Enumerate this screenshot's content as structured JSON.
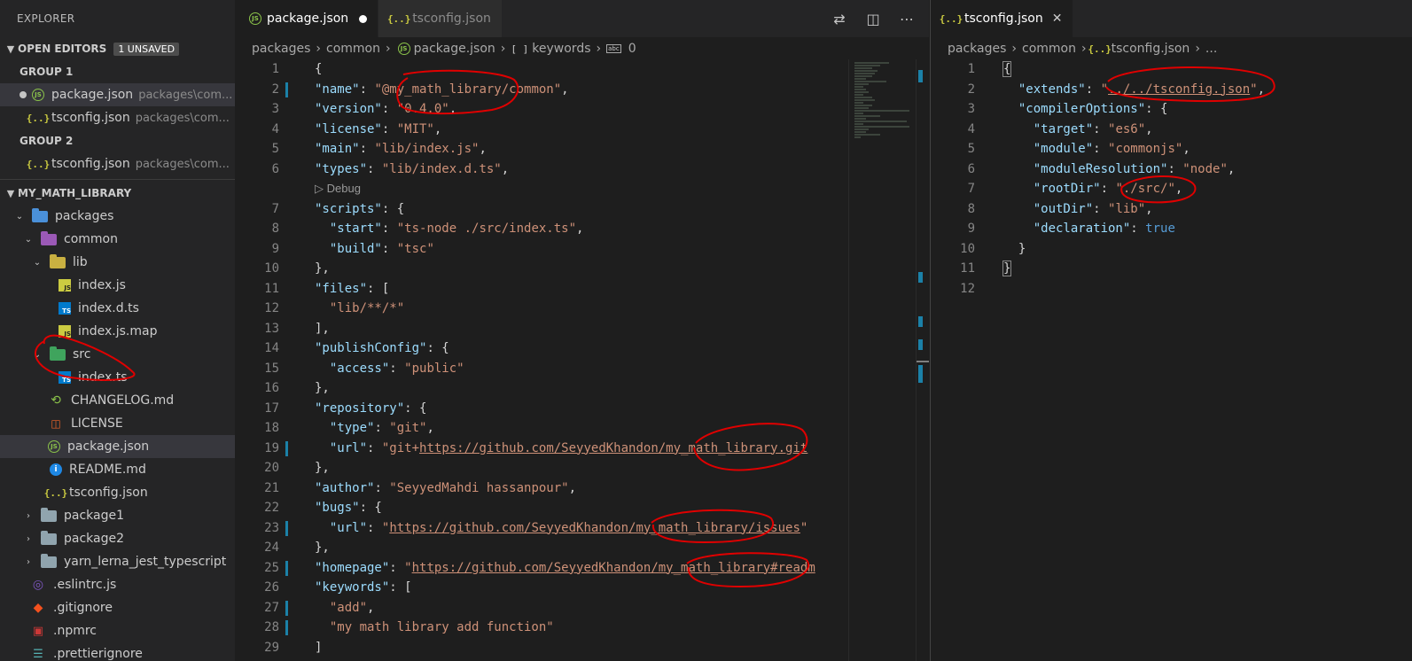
{
  "explorer": {
    "title": "EXPLORER",
    "open_editors": {
      "label": "OPEN EDITORS",
      "badge": "1 UNSAVED",
      "groups": [
        {
          "label": "GROUP 1",
          "files": [
            {
              "name": "package.json",
              "desc": "packages\\com...",
              "icon": "node-json-icon",
              "unsaved": true
            },
            {
              "name": "tsconfig.json",
              "desc": "packages\\com...",
              "icon": "json-braces-icon",
              "unsaved": false
            }
          ]
        },
        {
          "label": "GROUP 2",
          "files": [
            {
              "name": "tsconfig.json",
              "desc": "packages\\com...",
              "icon": "json-braces-icon",
              "unsaved": false
            }
          ]
        }
      ]
    },
    "workspace": {
      "label": "MY_MATH_LIBRARY",
      "tree": {
        "packages": "packages",
        "common": "common",
        "lib": "lib",
        "index_js": "index.js",
        "index_d_ts": "index.d.ts",
        "index_js_map": "index.js.map",
        "src": "src",
        "index_ts": "index.ts",
        "changelog": "CHANGELOG.md",
        "license": "LICENSE",
        "package_json": "package.json",
        "readme": "README.md",
        "tsconfig": "tsconfig.json",
        "package1": "package1",
        "package2": "package2",
        "yarn": "yarn_lerna_jest_typescript",
        "eslintrc": ".eslintrc.js",
        "gitignore": ".gitignore",
        "npmrc": ".npmrc",
        "prettierignore": ".prettierignore"
      }
    }
  },
  "editor1": {
    "tabs": [
      {
        "label": "package.json",
        "active": true,
        "unsaved": true
      },
      {
        "label": "tsconfig.json",
        "active": false
      }
    ],
    "breadcrumb": [
      "packages",
      "common",
      "package.json",
      "keywords",
      "0"
    ],
    "breadcrumb_symbol": "[ ]",
    "codelens": "Debug",
    "line_numbers": [
      "1",
      "2",
      "3",
      "4",
      "5",
      "6",
      "7",
      "8",
      "9",
      "10",
      "11",
      "12",
      "13",
      "14",
      "15",
      "16",
      "17",
      "18",
      "19",
      "20",
      "21",
      "22",
      "23",
      "24",
      "25",
      "26",
      "27",
      "28",
      "29"
    ],
    "code": {
      "l2k": "\"name\"",
      "l2v": "\"@my_math_library/common\"",
      "l3k": "\"version\"",
      "l3v": "\"0.4.0\"",
      "l4k": "\"license\"",
      "l4v": "\"MIT\"",
      "l5k": "\"main\"",
      "l5v": "\"lib/index.js\"",
      "l6k": "\"types\"",
      "l6v": "\"lib/index.d.ts\"",
      "l7k": "\"scripts\"",
      "l8k": "\"start\"",
      "l8v": "\"ts-node ./src/index.ts\"",
      "l9k": "\"build\"",
      "l9v": "\"tsc\"",
      "l11k": "\"files\"",
      "l12v": "\"lib/**/*\"",
      "l14k": "\"publishConfig\"",
      "l15k": "\"access\"",
      "l15v": "\"public\"",
      "l17k": "\"repository\"",
      "l18k": "\"type\"",
      "l18v": "\"git\"",
      "l19k": "\"url\"",
      "l19a": "\"git+",
      "l19u": "https://github.com/SeyyedKhandon/my_math_library.git",
      "l21k": "\"author\"",
      "l21v": "\"SeyyedMahdi hassanpour\"",
      "l22k": "\"bugs\"",
      "l23k": "\"url\"",
      "l23q": "\"",
      "l23u": "https://github.com/SeyyedKhandon/my_math_library/issues",
      "l23e": "\"",
      "l25k": "\"homepage\"",
      "l25q": "\"",
      "l25u": "https://github.com/SeyyedKhandon/my_math_library#readm",
      "l26k": "\"keywords\"",
      "l27v": "\"add\"",
      "l28v": "\"my math library add function\""
    }
  },
  "editor2": {
    "tabs": [
      {
        "label": "tsconfig.json",
        "active": true
      }
    ],
    "breadcrumb": [
      "packages",
      "common",
      "tsconfig.json",
      "..."
    ],
    "line_numbers": [
      "1",
      "2",
      "3",
      "4",
      "5",
      "6",
      "7",
      "8",
      "9",
      "10",
      "11",
      "12"
    ],
    "code": {
      "extends_k": "\"extends\"",
      "extends_v": "../../tsconfig.json",
      "co_k": "\"compilerOptions\"",
      "target_k": "\"target\"",
      "target_v": "\"es6\"",
      "module_k": "\"module\"",
      "module_v": "\"commonjs\"",
      "mr_k": "\"moduleResolution\"",
      "mr_v": "\"node\"",
      "root_k": "\"rootDir\"",
      "root_v": "\"./src/\"",
      "out_k": "\"outDir\"",
      "out_v": "\"lib\"",
      "decl_k": "\"declaration\"",
      "decl_v": "true"
    }
  },
  "colors": {
    "accent": "#007acc",
    "annotation": "#e00000",
    "string": "#ce9178",
    "key": "#9cdcfe"
  }
}
